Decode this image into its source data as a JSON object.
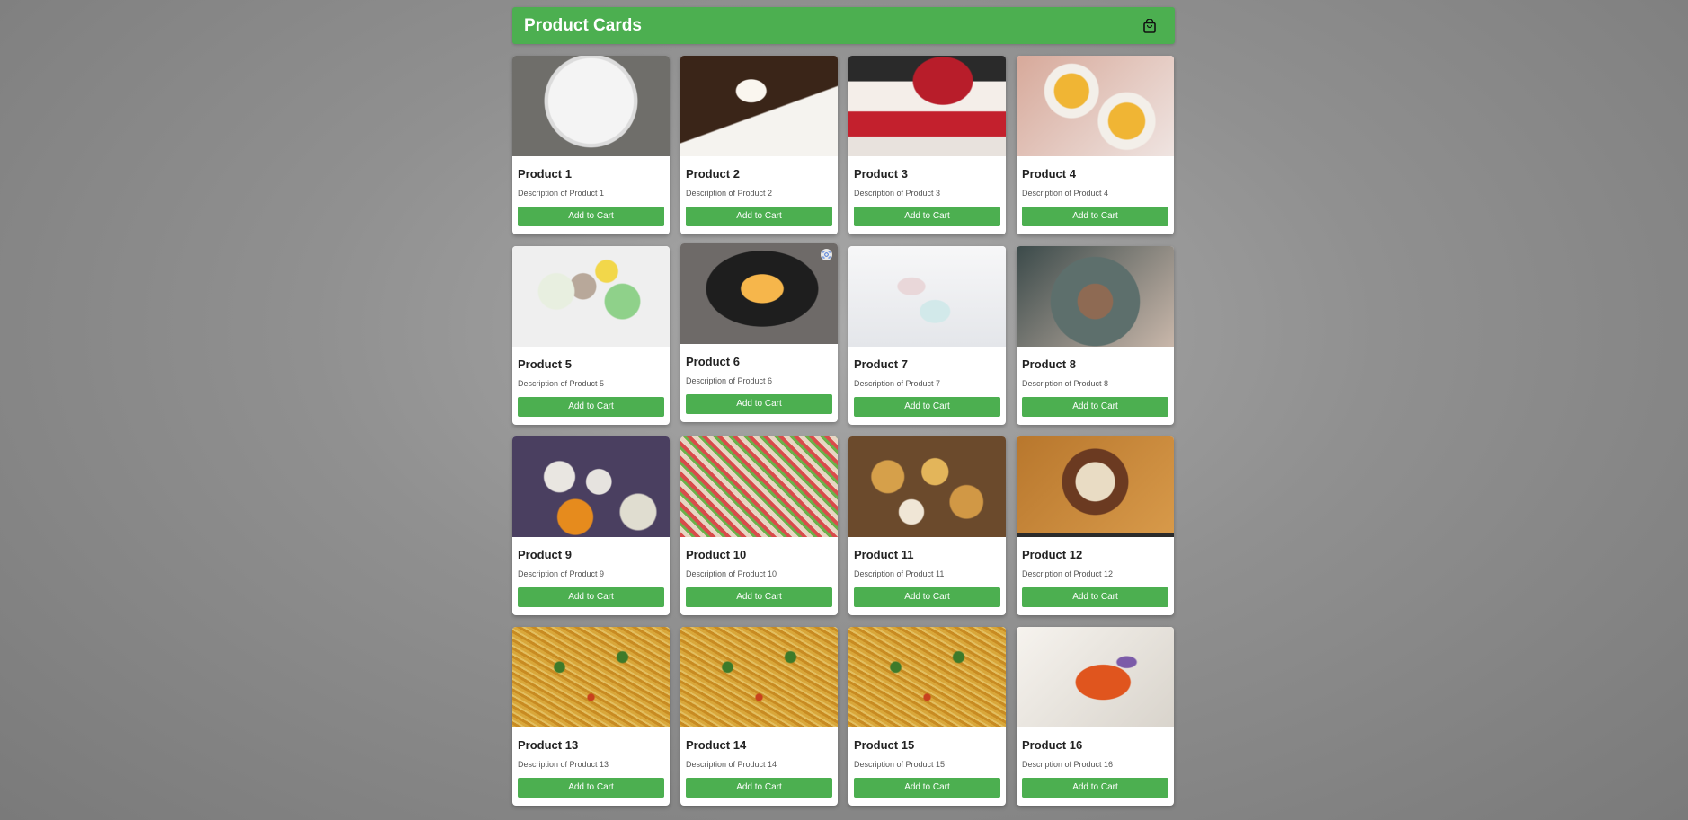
{
  "header": {
    "title": "Product Cards",
    "cart_icon": "shopping-bag-icon"
  },
  "colors": {
    "accent": "#4caf50",
    "page_background": "#8c8c8c"
  },
  "products": [
    {
      "name": "Product 1",
      "description": "Description of Product 1",
      "button": "Add to Cart"
    },
    {
      "name": "Product 2",
      "description": "Description of Product 2",
      "button": "Add to Cart"
    },
    {
      "name": "Product 3",
      "description": "Description of Product 3",
      "button": "Add to Cart"
    },
    {
      "name": "Product 4",
      "description": "Description of Product 4",
      "button": "Add to Cart"
    },
    {
      "name": "Product 5",
      "description": "Description of Product 5",
      "button": "Add to Cart"
    },
    {
      "name": "Product 6",
      "description": "Description of Product 6",
      "button": "Add to Cart"
    },
    {
      "name": "Product 7",
      "description": "Description of Product 7",
      "button": "Add to Cart"
    },
    {
      "name": "Product 8",
      "description": "Description of Product 8",
      "button": "Add to Cart"
    },
    {
      "name": "Product 9",
      "description": "Description of Product 9",
      "button": "Add to Cart"
    },
    {
      "name": "Product 10",
      "description": "Description of Product 10",
      "button": "Add to Cart"
    },
    {
      "name": "Product 11",
      "description": "Description of Product 11",
      "button": "Add to Cart"
    },
    {
      "name": "Product 12",
      "description": "Description of Product 12",
      "button": "Add to Cart"
    },
    {
      "name": "Product 13",
      "description": "Description of Product 13",
      "button": "Add to Cart"
    },
    {
      "name": "Product 14",
      "description": "Description of Product 14",
      "button": "Add to Cart"
    },
    {
      "name": "Product 15",
      "description": "Description of Product 15",
      "button": "Add to Cart"
    },
    {
      "name": "Product 16",
      "description": "Description of Product 16",
      "button": "Add to Cart"
    }
  ]
}
